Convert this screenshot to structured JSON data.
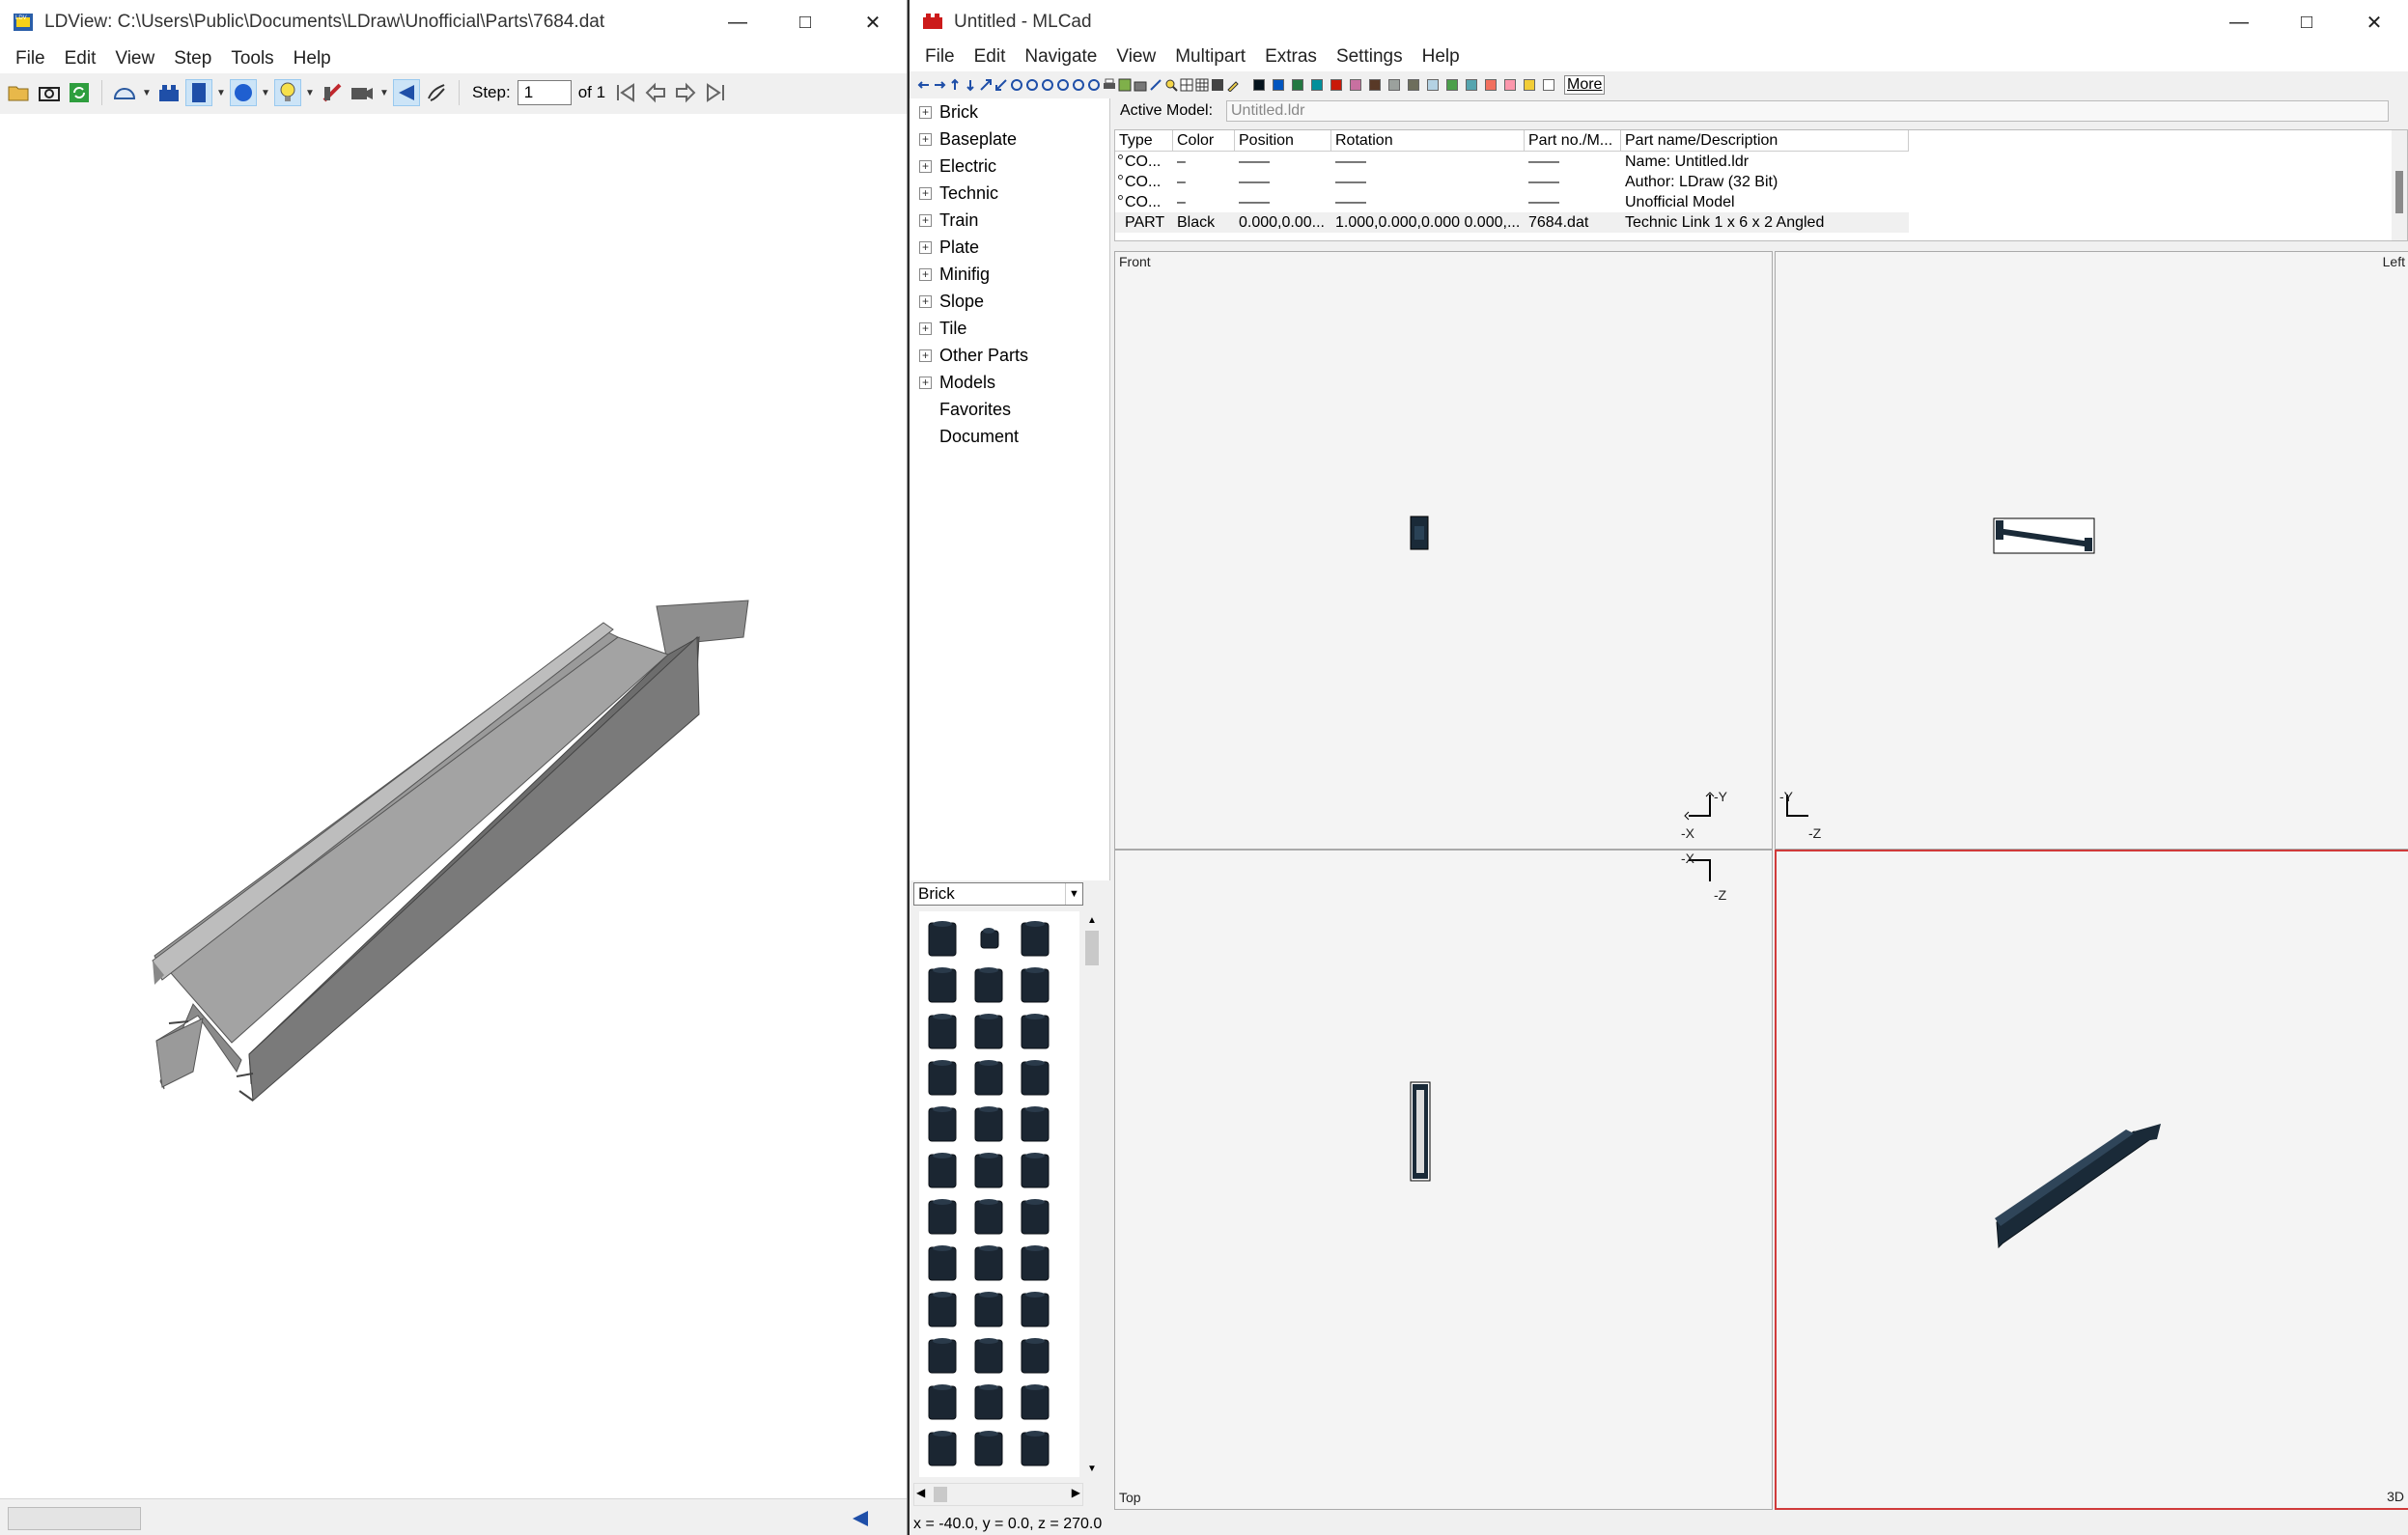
{
  "ldview": {
    "title": "LDView: C:\\Users\\Public\\Documents\\LDraw\\Unofficial\\Parts\\7684.dat",
    "menu": [
      "File",
      "Edit",
      "View",
      "Step",
      "Tools",
      "Help"
    ],
    "step_label": "Step:",
    "step_value": "1",
    "step_of": "of 1"
  },
  "mlcad": {
    "title": "Untitled - MLCad",
    "menu": [
      "File",
      "Edit",
      "Navigate",
      "View",
      "Multipart",
      "Extras",
      "Settings",
      "Help"
    ],
    "more_label": "More",
    "colors": [
      "#05131d",
      "#0055bf",
      "#237841",
      "#008f9b",
      "#c91a09",
      "#c870a0",
      "#583927",
      "#9ba19d",
      "#6d6e5c",
      "#b4d2e3",
      "#4b9f4a",
      "#55a5af",
      "#f2705e",
      "#fc97ac",
      "#f2cd37",
      "#ffffff"
    ],
    "tree": [
      "Brick",
      "Baseplate",
      "Electric",
      "Technic",
      "Train",
      "Plate",
      "Minifig",
      "Slope",
      "Tile",
      "Other Parts",
      "Models",
      "Favorites",
      "Document"
    ],
    "category": "Brick",
    "active_model_label": "Active Model:",
    "active_model_value": "Untitled.ldr",
    "table": {
      "headers": [
        "Type",
        "Color",
        "Position",
        "Rotation",
        "Part no./M...",
        "Part name/Description"
      ],
      "rows": [
        [
          "CO...",
          "–",
          "——",
          "——",
          "——",
          "Name: Untitled.ldr"
        ],
        [
          "CO...",
          "–",
          "——",
          "——",
          "——",
          "Author: LDraw (32 Bit)"
        ],
        [
          "CO...",
          "–",
          "——",
          "——",
          "——",
          "Unofficial Model"
        ],
        [
          "PART",
          "Black",
          "0.000,0.00...",
          "1.000,0.000,0.000 0.000,...",
          "7684.dat",
          "Technic Link  1 x  6 x  2 Angled"
        ]
      ]
    },
    "views": {
      "front": "Front",
      "left": "Left",
      "top": "Top",
      "three_d": "3D"
    },
    "axes": {
      "front_up": "-Y",
      "front_side": "-X",
      "left_up": "-Y",
      "left_side": "-Z",
      "top_side": "-X",
      "top_down": "-Z"
    },
    "status": "x = -40.0, y = 0.0, z = 270.0"
  }
}
